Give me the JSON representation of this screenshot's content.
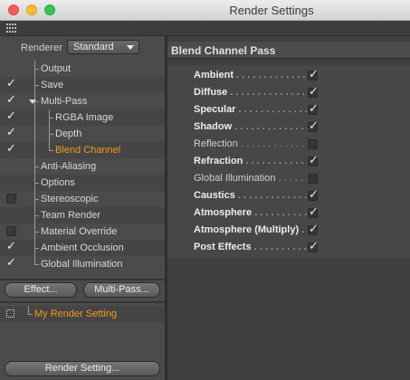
{
  "window": {
    "title": "Render Settings"
  },
  "renderer": {
    "label": "Renderer",
    "value": "Standard"
  },
  "tree": [
    {
      "label": "Output",
      "checked": null,
      "depth": 1
    },
    {
      "label": "Save",
      "checked": true,
      "depth": 1
    },
    {
      "label": "Multi-Pass",
      "checked": true,
      "depth": 1,
      "expanded": true
    },
    {
      "label": "RGBA Image",
      "checked": true,
      "depth": 2
    },
    {
      "label": "Depth",
      "checked": true,
      "depth": 2
    },
    {
      "label": "Blend Channel",
      "checked": true,
      "depth": 2,
      "selected": true
    },
    {
      "label": "Anti-Aliasing",
      "checked": null,
      "depth": 1
    },
    {
      "label": "Options",
      "checked": null,
      "depth": 1
    },
    {
      "label": "Stereoscopic",
      "checked": false,
      "depth": 1
    },
    {
      "label": "Team Render",
      "checked": null,
      "depth": 1
    },
    {
      "label": "Material Override",
      "checked": false,
      "depth": 1
    },
    {
      "label": "Ambient Occlusion",
      "checked": true,
      "depth": 1
    },
    {
      "label": "Global Illumination",
      "checked": true,
      "depth": 1
    }
  ],
  "buttons": {
    "effect": "Effect...",
    "multipass": "Multi-Pass...",
    "render_setting": "Render Setting..."
  },
  "render_setting_item": "My Render Setting",
  "panel": {
    "title": "Blend Channel Pass",
    "properties": [
      {
        "label": "Ambient",
        "checked": true
      },
      {
        "label": "Diffuse",
        "checked": true
      },
      {
        "label": "Specular",
        "checked": true
      },
      {
        "label": "Shadow",
        "checked": true
      },
      {
        "label": "Reflection",
        "checked": false
      },
      {
        "label": "Refraction",
        "checked": true
      },
      {
        "label": "Global Illumination",
        "checked": false
      },
      {
        "label": "Caustics",
        "checked": true
      },
      {
        "label": "Atmosphere",
        "checked": true
      },
      {
        "label": "Atmosphere (Multiply)",
        "checked": true
      },
      {
        "label": "Post Effects",
        "checked": true
      }
    ]
  },
  "colors": {
    "selected_text": "#f39a12"
  }
}
